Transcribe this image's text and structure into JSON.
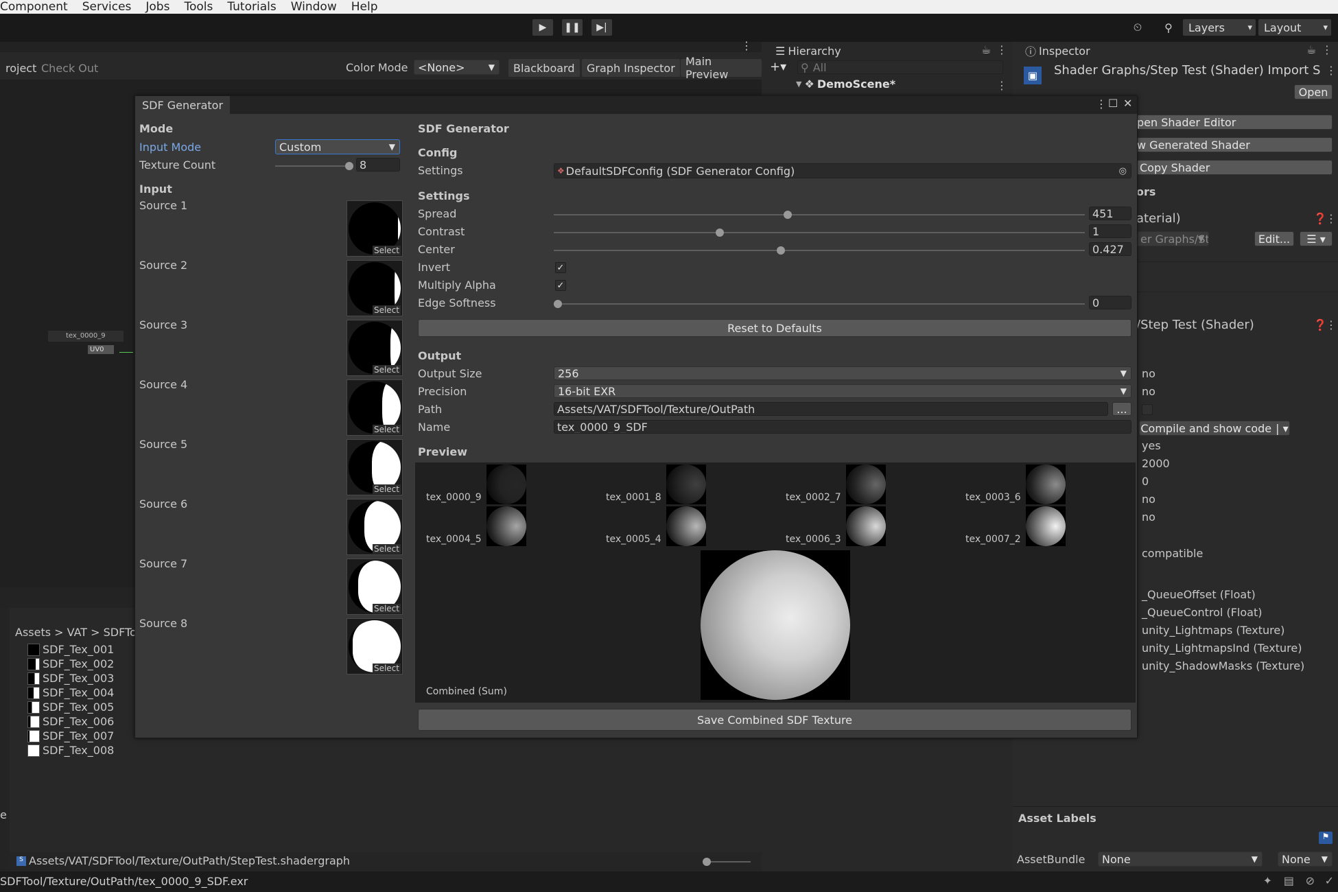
{
  "menu": [
    "Component",
    "Services",
    "Jobs",
    "Tools",
    "Tutorials",
    "Window",
    "Help"
  ],
  "toolbar": {
    "layers": "Layers",
    "layout": "Layout"
  },
  "graph": {
    "tab_project": "roject",
    "tab_checkout": "Check Out",
    "color_mode_label": "Color Mode",
    "color_mode_value": "<None>",
    "btn_blackboard": "Blackboard",
    "btn_graph_inspector": "Graph Inspector",
    "btn_main_preview": "Main Preview",
    "node_label": "tex_0000_9",
    "uv_label": "UV0"
  },
  "project": {
    "breadcrumb": [
      "Assets",
      "VAT",
      "SDFTo"
    ],
    "files": [
      "SDF_Tex_001",
      "SDF_Tex_002",
      "SDF_Tex_003",
      "SDF_Tex_004",
      "SDF_Tex_005",
      "SDF_Tex_006",
      "SDF_Tex_007",
      "SDF_Tex_008"
    ],
    "bottom_path": "Assets/VAT/SDFTool/Texture/OutPath/StepTest.shadergraph",
    "side_letter": "e"
  },
  "status_bar": "SDFTool/Texture/OutPath/tex_0000_9_SDF.exr",
  "hierarchy": {
    "title": "Hierarchy",
    "search_placeholder": "All",
    "scene": "DemoScene*"
  },
  "inspector": {
    "title": "Inspector",
    "asset_title": "Shader Graphs/Step Test (Shader) Import S",
    "open": "Open",
    "btn_open_editor": "pen Shader Editor",
    "btn_generated": "w Generated Shader",
    "btn_copy": "Copy Shader",
    "section_ors": "ors",
    "material": "aterial)",
    "graph_ref": "er Graphs/StepTes",
    "edit": "Edit...",
    "shader_title": "/Step Test (Shader)",
    "values": [
      "no",
      "no",
      "yes",
      "2000",
      "0",
      "no",
      "no"
    ],
    "compile_btn": "Compile and show code",
    "compat": "compatible",
    "props": [
      "_QueueOffset (Float)",
      "_QueueControl (Float)",
      "unity_Lightmaps (Texture)",
      "unity_LightmapsInd (Texture)",
      "unity_ShadowMasks (Texture)"
    ],
    "asset_labels": "Asset Labels",
    "assetbundle_label": "AssetBundle",
    "assetbundle_value": "None",
    "variant_value": "None"
  },
  "window": {
    "title": "SDF Generator",
    "left": {
      "mode_header": "Mode",
      "input_mode_label": "Input Mode",
      "input_mode_value": "Custom",
      "texture_count_label": "Texture Count",
      "texture_count_value": "8",
      "input_header": "Input",
      "select_label": "Select",
      "sources": [
        "Source 1",
        "Source 2",
        "Source 3",
        "Source 4",
        "Source 5",
        "Source 6",
        "Source 7",
        "Source 8"
      ]
    },
    "right": {
      "title": "SDF Generator",
      "config_header": "Config",
      "settings_label": "Settings",
      "settings_value": "DefaultSDFConfig (SDF Generator Config)",
      "settings_header": "Settings",
      "spread_label": "Spread",
      "spread_value": "451",
      "spread_fraction": 0.44,
      "contrast_label": "Contrast",
      "contrast_value": "1",
      "contrast_fraction": 0.31,
      "center_label": "Center",
      "center_value": "0.427",
      "center_fraction": 0.427,
      "invert_label": "Invert",
      "multiply_alpha_label": "Multiply Alpha",
      "edge_softness_label": "Edge Softness",
      "edge_softness_value": "0",
      "edge_softness_fraction": 0,
      "reset_btn": "Reset to Defaults",
      "output_header": "Output",
      "output_size_label": "Output Size",
      "output_size_value": "256",
      "precision_label": "Precision",
      "precision_value": "16-bit EXR",
      "path_label": "Path",
      "path_value": "Assets/VAT/SDFTool/Texture/OutPath",
      "browse": "...",
      "name_label": "Name",
      "name_value": "tex_0000_9_SDF",
      "preview_header": "Preview",
      "preview_tiles": [
        "tex_0000_9",
        "tex_0001_8",
        "tex_0002_7",
        "tex_0003_6",
        "tex_0004_5",
        "tex_0005_4",
        "tex_0006_3",
        "tex_0007_2"
      ],
      "combined_label": "Combined (Sum)",
      "save_btn": "Save Combined SDF Texture"
    }
  }
}
